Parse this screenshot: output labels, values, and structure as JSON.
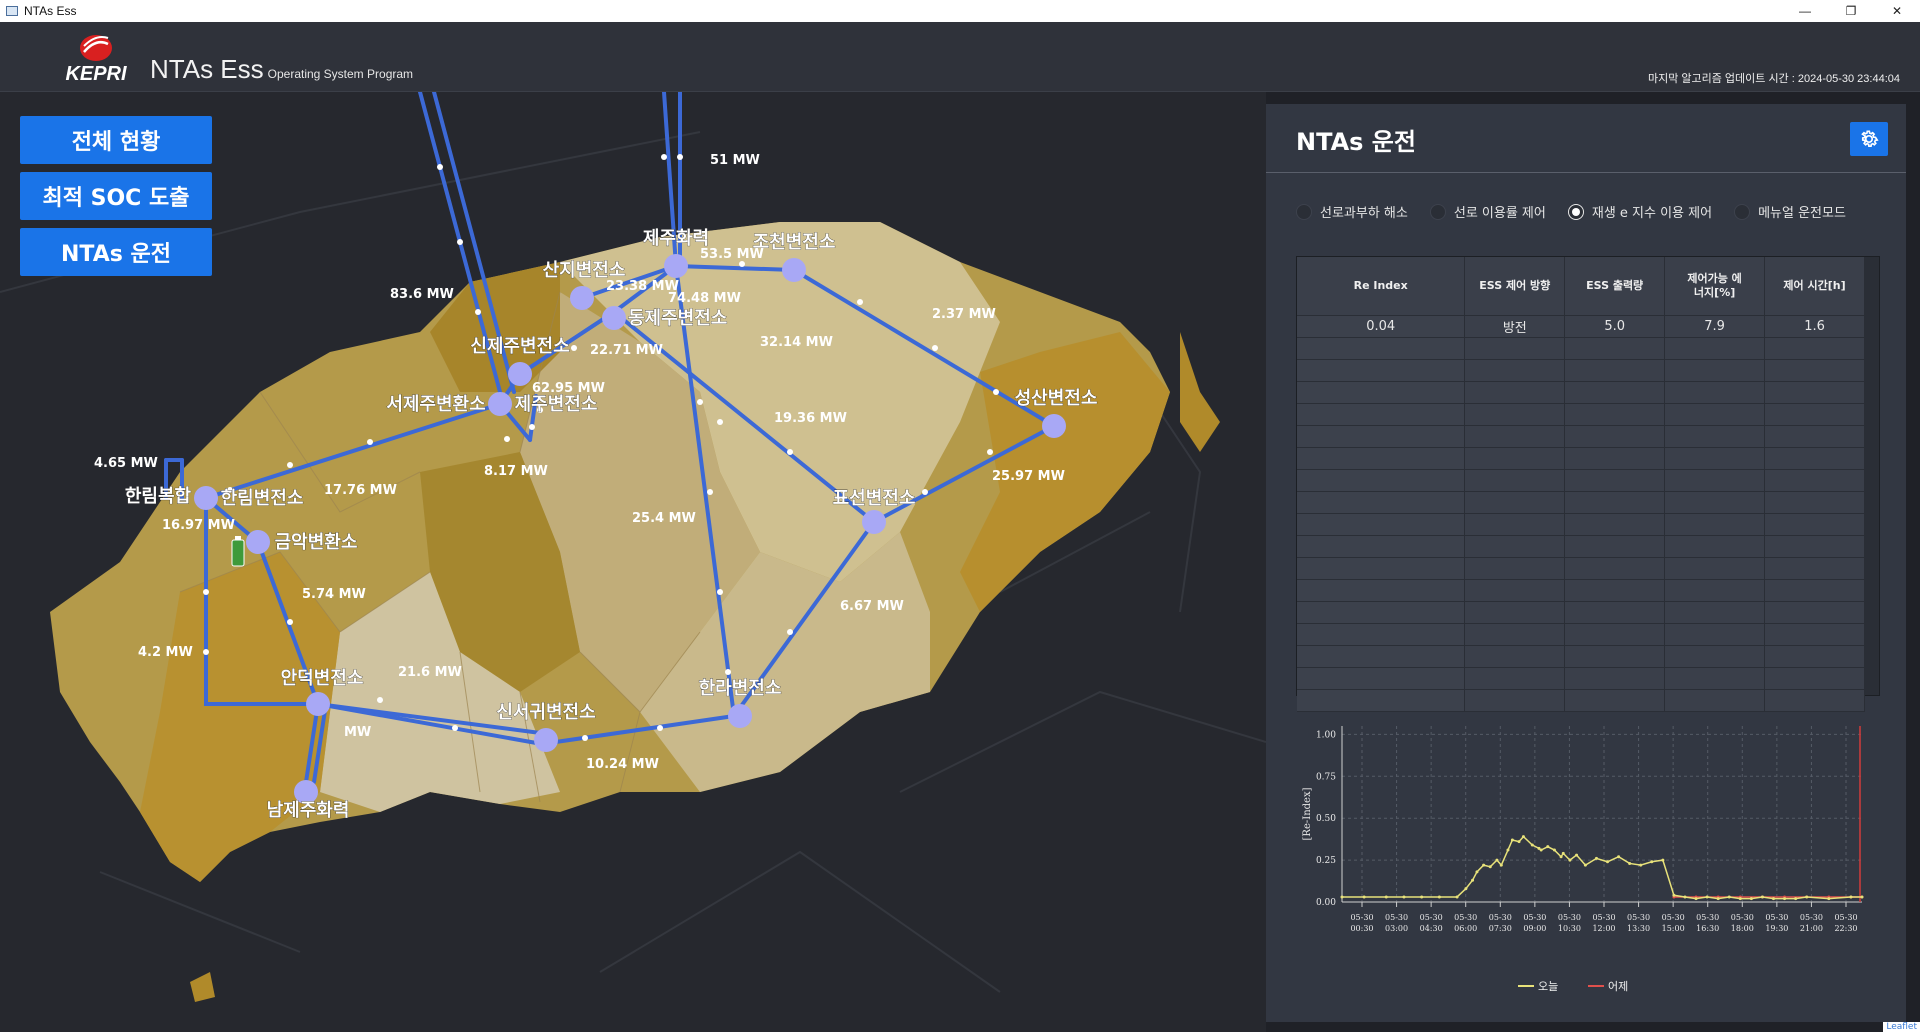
{
  "window": {
    "title": "NTAs Ess",
    "minimize": "—",
    "maximize": "❐",
    "close": "✕"
  },
  "header": {
    "logo_text": "KEPRI",
    "app_name": "NTAs Ess",
    "app_subtitle": "Operating System Program",
    "update_time": "마지막 알고리즘 업데이트 시간 : 2024-05-30 23:44:04"
  },
  "nav": {
    "overview": "전체 현황",
    "soc": "최적 SOC 도출",
    "ntas": "NTAs 운전"
  },
  "map": {
    "stations": [
      {
        "name": "제주화력"
      },
      {
        "name": "조천변전소"
      },
      {
        "name": "산지변전소"
      },
      {
        "name": "동제주변전소"
      },
      {
        "name": "신제주변전소"
      },
      {
        "name": "서제주변환소"
      },
      {
        "name": "제주변전소"
      },
      {
        "name": "성산변전소"
      },
      {
        "name": "한림복합"
      },
      {
        "name": "한림변전소"
      },
      {
        "name": "금악변환소"
      },
      {
        "name": "표선변전소"
      },
      {
        "name": "안덕변전소"
      },
      {
        "name": "신서귀변전소"
      },
      {
        "name": "한라변전소"
      },
      {
        "name": "남제주화력"
      }
    ],
    "flows": [
      "51 MW",
      "53.5 MW",
      "23.38 MW",
      "74.48 MW",
      "83.6 MW",
      "22.71 MW",
      "2.37 MW",
      "32.14 MW",
      "62.95 MW",
      "19.36 MW",
      "4.65 MW",
      "8.17 MW",
      "17.76 MW",
      "25.97 MW",
      "16.97 MW",
      "25.4 MW",
      "5.74 MW",
      "6.67 MW",
      "4.2 MW",
      "21.6 MW",
      "MW",
      "10.24 MW"
    ],
    "attribution": "Leaflet"
  },
  "panel": {
    "title": "NTAs 운전",
    "modes": [
      {
        "label": "선로과부하 해소",
        "selected": false
      },
      {
        "label": "선로 이용률 제어",
        "selected": false
      },
      {
        "label": "재생 e 지수 이용 제어",
        "selected": true
      },
      {
        "label": "메뉴얼 운전모드",
        "selected": false
      }
    ],
    "table": {
      "headers": [
        "Re Index",
        "ESS 제어 방향",
        "ESS 출력량",
        "제어가능 에너지[%]",
        "제어 시간[h]"
      ],
      "rows": [
        [
          "0.04",
          "방전",
          "5.0",
          "7.9",
          "1.6"
        ]
      ]
    }
  },
  "chart_data": {
    "type": "line",
    "ylabel": "[Re-Index]",
    "ylim": [
      0,
      1.05
    ],
    "yticks": [
      "1.00",
      "0.75",
      "0.50",
      "0.25",
      "0.00"
    ],
    "xticks": [
      [
        "05-30",
        "00:30"
      ],
      [
        "05-30",
        "03:00"
      ],
      [
        "05-30",
        "04:30"
      ],
      [
        "05-30",
        "06:00"
      ],
      [
        "05-30",
        "07:30"
      ],
      [
        "05-30",
        "09:00"
      ],
      [
        "05-30",
        "10:30"
      ],
      [
        "05-30",
        "12:00"
      ],
      [
        "05-30",
        "13:30"
      ],
      [
        "05-30",
        "15:00"
      ],
      [
        "05-30",
        "16:30"
      ],
      [
        "05-30",
        "18:00"
      ],
      [
        "05-30",
        "19:30"
      ],
      [
        "05-30",
        "21:00"
      ],
      [
        "05-30",
        "22:30"
      ]
    ],
    "series": [
      {
        "name": "오늘",
        "color": "#e8e27a",
        "x": [
          0,
          1,
          2,
          2.8,
          3.6,
          4.4,
          5.2,
          5.6,
          5.9,
          6.1,
          6.4,
          6.7,
          7.0,
          7.2,
          7.5,
          7.7,
          8.0,
          8.2,
          8.6,
          8.9,
          9.0,
          9.3,
          9.6,
          9.9,
          10.0,
          10.3,
          10.6,
          11.0,
          11.5,
          12.0,
          12.5,
          13.0,
          13.5,
          14.0,
          14.5,
          15.0,
          15.5,
          16.0,
          16.5,
          17.0,
          17.5,
          18.0,
          18.5,
          19.0,
          19.5,
          20.0,
          20.5,
          21.0,
          22.0,
          23.0,
          23.5
        ],
        "y": [
          0.03,
          0.03,
          0.03,
          0.03,
          0.03,
          0.03,
          0.03,
          0.08,
          0.13,
          0.18,
          0.22,
          0.21,
          0.25,
          0.22,
          0.31,
          0.37,
          0.36,
          0.39,
          0.34,
          0.32,
          0.31,
          0.33,
          0.31,
          0.27,
          0.29,
          0.25,
          0.28,
          0.22,
          0.26,
          0.24,
          0.27,
          0.23,
          0.22,
          0.24,
          0.25,
          0.04,
          0.03,
          0.02,
          0.03,
          0.02,
          0.03,
          0.02,
          0.02,
          0.03,
          0.02,
          0.02,
          0.02,
          0.03,
          0.02,
          0.03,
          0.03
        ]
      },
      {
        "name": "어제",
        "color": "#e0504c",
        "x": [
          15.0,
          16.0,
          17.0,
          18.0,
          19.0,
          20.0,
          21.0,
          22.0,
          23.0,
          23.5
        ],
        "y": [
          0.03,
          0.03,
          0.03,
          0.03,
          0.03,
          0.03,
          0.03,
          0.03,
          0.03,
          0.03
        ]
      }
    ]
  }
}
